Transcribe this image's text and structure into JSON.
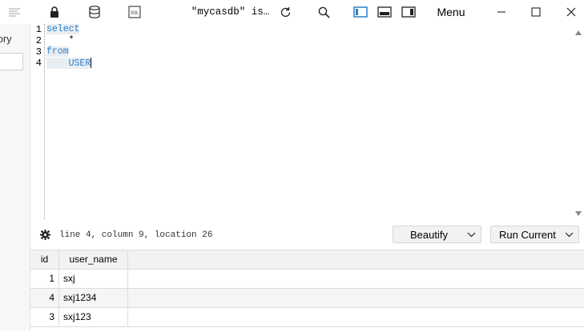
{
  "toolbar": {
    "title": "\"mycasdb\" is…",
    "menu_label": "Menu",
    "icons": [
      "list-icon",
      "lock-icon",
      "database-icon",
      "sql-icon",
      "refresh-icon",
      "search-icon",
      "layout-left-icon",
      "layout-bottom-icon",
      "layout-right-icon",
      "minimize-icon",
      "maximize-icon",
      "close-icon"
    ]
  },
  "sidebar": {
    "label": "tory"
  },
  "editor": {
    "line_numbers": [
      "1",
      "2",
      "3",
      "4"
    ],
    "lines": [
      {
        "keyword": "select"
      },
      {
        "text": "    *"
      },
      {
        "keyword": "from"
      },
      {
        "indent": "    ",
        "table": "USER"
      }
    ]
  },
  "status": {
    "cursor_info": "line 4, column 9, location 26",
    "beautify_label": "Beautify",
    "run_label": "Run Current"
  },
  "results": {
    "columns": [
      "id",
      "user_name"
    ],
    "rows": [
      {
        "id": "1",
        "user_name": "sxj"
      },
      {
        "id": "4",
        "user_name": "sxj1234"
      },
      {
        "id": "3",
        "user_name": "sxj123"
      }
    ]
  },
  "colors": {
    "keyword": "#2a7fc7",
    "active_layout": "#2a7fc7"
  }
}
